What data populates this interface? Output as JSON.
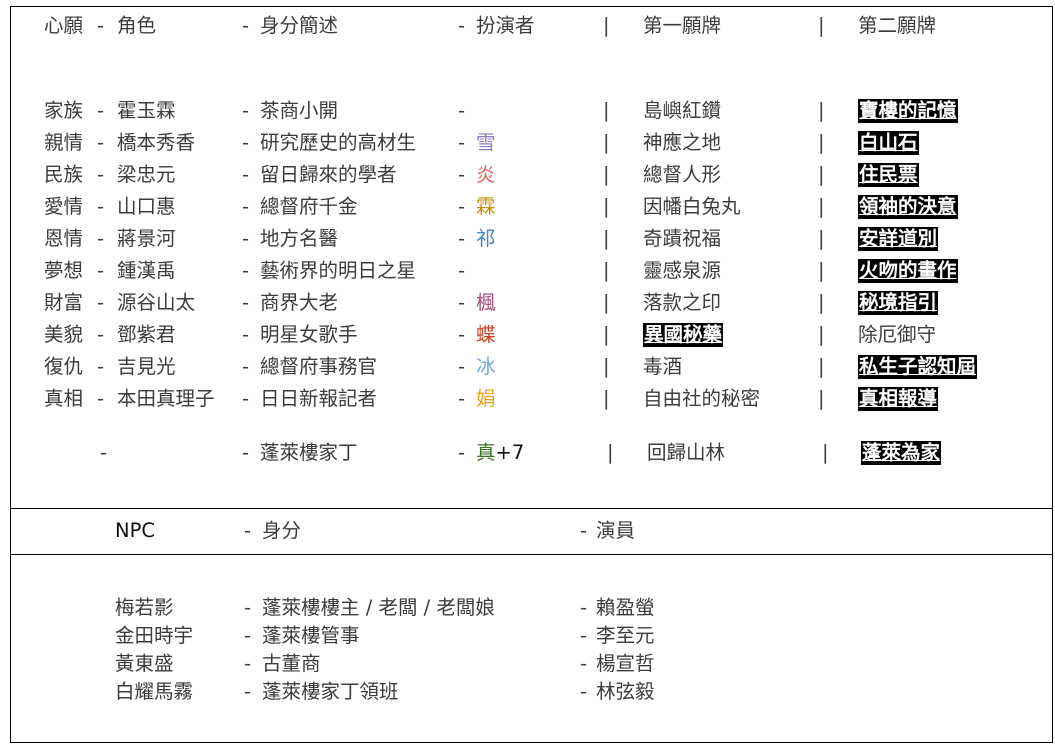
{
  "header": {
    "wish": "心願",
    "role": "角色",
    "identity": "身分簡述",
    "actor": "扮演者",
    "sep": "|",
    "card1": "第一願牌",
    "card2": "第二願牌",
    "dash": "-"
  },
  "rows": [
    {
      "wish": "家族",
      "role": "霍玉霖",
      "identity": "茶商小開",
      "actor": "",
      "actor_color": "#3c3c3c",
      "card1": "島嶼紅鑽",
      "card1_hl": false,
      "card2": "寶樓的記憶",
      "card2_hl": true
    },
    {
      "wish": "親情",
      "role": "橋本秀香",
      "identity": "研究歷史的高材生",
      "actor": "雪",
      "actor_color": "#8e7cc3",
      "card1": "神應之地",
      "card1_hl": false,
      "card2": "白山石",
      "card2_hl": true
    },
    {
      "wish": "民族",
      "role": "梁忠元",
      "identity": "留日歸來的學者",
      "actor": "炎",
      "actor_color": "#e06666",
      "card1": "總督人形",
      "card1_hl": false,
      "card2": "住民票",
      "card2_hl": true
    },
    {
      "wish": "愛情",
      "role": "山口惠",
      "identity": "總督府千金",
      "actor": "霖",
      "actor_color": "#bf9000",
      "card1": "因幡白兔丸",
      "card1_hl": false,
      "card2": "領袖的決意",
      "card2_hl": true
    },
    {
      "wish": "恩情",
      "role": "蔣景河",
      "identity": "地方名醫",
      "actor": "祁",
      "actor_color": "#3d85c6",
      "card1": "奇蹟祝福",
      "card1_hl": false,
      "card2": "安詳道別",
      "card2_hl": true
    },
    {
      "wish": "夢想",
      "role": "鍾漢禹",
      "identity": "藝術界的明日之星",
      "actor": "",
      "actor_color": "#3c3c3c",
      "card1": "靈感泉源",
      "card1_hl": false,
      "card2": "火吻的畫作",
      "card2_hl": true
    },
    {
      "wish": "財富",
      "role": "源谷山太",
      "identity": "商界大老",
      "actor": "楓",
      "actor_color": "#a64d79",
      "card1": "落款之印",
      "card1_hl": false,
      "card2": "秘境指引",
      "card2_hl": true
    },
    {
      "wish": "美貌",
      "role": "鄧紫君",
      "identity": "明星女歌手",
      "actor": "蝶",
      "actor_color": "#cc4125",
      "card1": "異國秘藥",
      "card1_hl": true,
      "card2": "除厄御守",
      "card2_hl": false
    },
    {
      "wish": "復仇",
      "role": "吉見光",
      "identity": "總督府事務官",
      "actor": "冰",
      "actor_color": "#6fa8dc",
      "card1": "毒酒",
      "card1_hl": false,
      "card2": "私生子認知屆",
      "card2_hl": true
    },
    {
      "wish": "真相",
      "role": "本田真理子",
      "identity": "日日新報記者",
      "actor": "娟",
      "actor_color": "#f1a11b",
      "card1": "自由社的秘密",
      "card1_hl": false,
      "card2": "真相報導",
      "card2_hl": true
    }
  ],
  "extra": {
    "wish": "-",
    "identity": "蓬萊樓家丁",
    "actor": "真",
    "actor_color": "#38761d",
    "actor_suffix": "+7",
    "card1": "回歸山林",
    "card2": "蓬萊為家"
  },
  "npc_header": {
    "npc": "NPC",
    "identity": "身分",
    "actor": "演員"
  },
  "npcs": [
    {
      "name": "梅若影",
      "identity": "蓬萊樓樓主 / 老闆 / 老闆娘",
      "actor": "賴盈螢"
    },
    {
      "name": "金田時宇",
      "identity": "蓬萊樓管事",
      "actor": "李至元"
    },
    {
      "name": "黃東盛",
      "identity": "古董商",
      "actor": "楊宣哲"
    },
    {
      "name": "白耀馬霧",
      "identity": "蓬萊樓家丁領班",
      "actor": "林弦毅"
    }
  ],
  "colors": {
    "border": "#000000",
    "text": "#3c3c3c",
    "highlight_bg": "#000000",
    "highlight_fg": "#ffffff"
  }
}
